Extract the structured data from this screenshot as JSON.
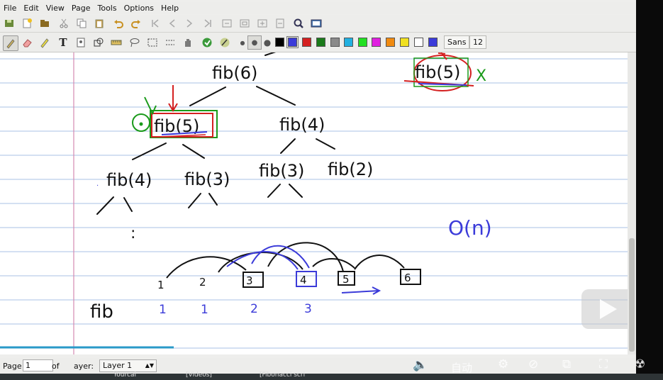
{
  "menu": [
    "File",
    "Edit",
    "View",
    "Page",
    "Tools",
    "Options",
    "Help"
  ],
  "font": {
    "family": "Sans",
    "size": "12"
  },
  "palette": [
    "#000000",
    "#3b3bd9",
    "#d42020",
    "#1a7a1a",
    "#8a8a8a",
    "#22b0e0",
    "#22e022",
    "#e020e0",
    "#f08a10",
    "#f0e020",
    "#ffffff",
    "#3b3bd9"
  ],
  "canvas": {
    "tree": {
      "root": "fib(6)",
      "l1": [
        "fib(5)",
        "fib(4)"
      ],
      "l2": [
        "fib(4)",
        "fib(3)",
        "fib(3)",
        "fib(2)"
      ],
      "corner": "fib(5)",
      "cross": "X",
      "dots": ":"
    },
    "complexity": "O(n)",
    "row_label": "fib",
    "numbers": [
      "1",
      "2",
      "3",
      "4",
      "5",
      "6"
    ],
    "values": [
      "1",
      "1",
      "2",
      "3"
    ]
  },
  "status": {
    "page_label": "Page",
    "page_value": "1",
    "of_label": "of",
    "layer_label": "ayer:",
    "layer_value": "Layer 1"
  },
  "overlay": {
    "auto_label": "自动"
  },
  "taskbar": {
    "items": [
      "Yourcal",
      "[Videos]",
      "[Fibonacci scri"
    ]
  }
}
